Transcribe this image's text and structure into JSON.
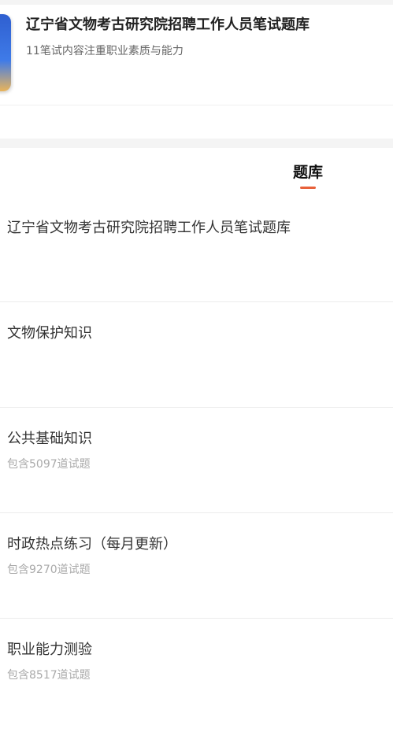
{
  "header": {
    "cover_icon": "book-cover-icon",
    "title": "辽宁省文物考古研究院招聘工作人员笔试题库",
    "subtitle": "11笔试内容注重职业素质与能力"
  },
  "tabs": [
    {
      "label": "题库",
      "active": true,
      "accent_color": "#e8613a"
    }
  ],
  "items": [
    {
      "title": "辽宁省文物考古研究院招聘工作人员笔试题库",
      "count": ""
    },
    {
      "title": "文物保护知识",
      "count": ""
    },
    {
      "title": "公共基础知识",
      "count": "包含5097道试题"
    },
    {
      "title": "时政热点练习（每月更新）",
      "count": "包含9270道试题"
    },
    {
      "title": "职业能力测验",
      "count": "包含8517道试题"
    }
  ]
}
